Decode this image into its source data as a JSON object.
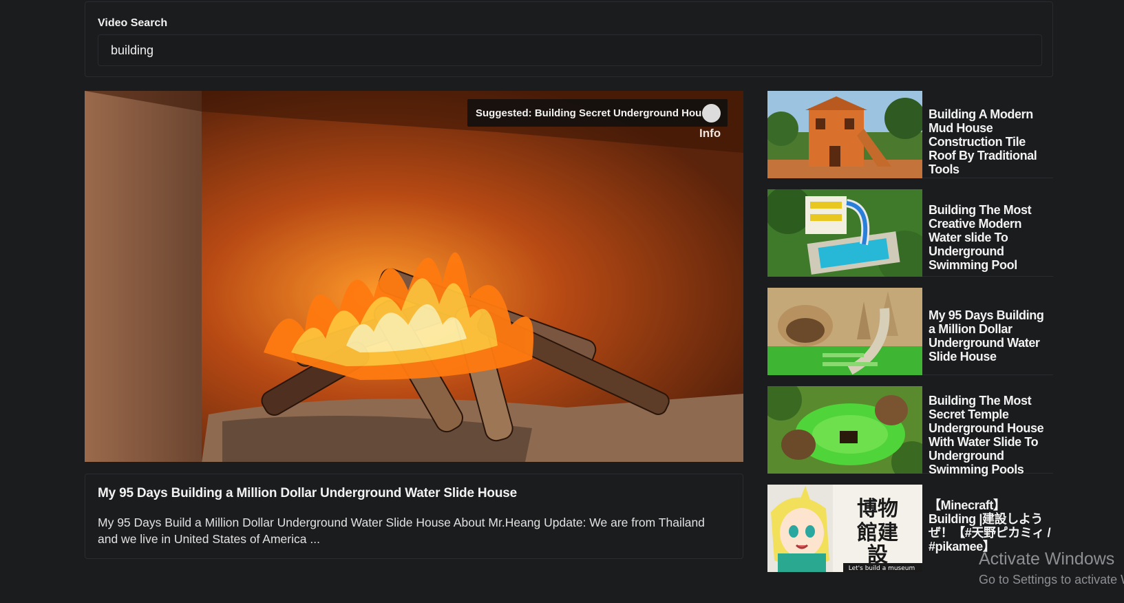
{
  "search": {
    "label": "Video Search",
    "value": "building"
  },
  "player": {
    "suggested_label": "Suggested: Building Secret Underground House",
    "info_label": "Info"
  },
  "description": {
    "title": "My 95 Days Building a Million Dollar Underground Water Slide House",
    "text": "My 95 Days Build a Million Dollar Underground Water Slide House About Mr.Heang Update: We are from Thailand and we live in United States of America ..."
  },
  "sidebar": {
    "items": [
      {
        "title": "Building A Modern Mud House Construction Tile Roof By Traditional Tools"
      },
      {
        "title": "Building The Most Creative Modern Water slide To Underground Swimming Pool"
      },
      {
        "title": "My 95 Days Building a Million Dollar Underground Water Slide House"
      },
      {
        "title": "Building The Most Secret Temple Underground House With Water Slide To Underground Swimming Pools"
      },
      {
        "title": "【Minecraft】Building |建設しようぜ！【#天野ピカミィ / #pikamee】",
        "thumb_text_jp": "博物館建設 文明開花の音がしない",
        "thumb_text_en": "Let's build a museum"
      }
    ]
  },
  "os_watermark": {
    "line1": "Activate Windows",
    "line2": "Go to Settings to activate Windows."
  }
}
